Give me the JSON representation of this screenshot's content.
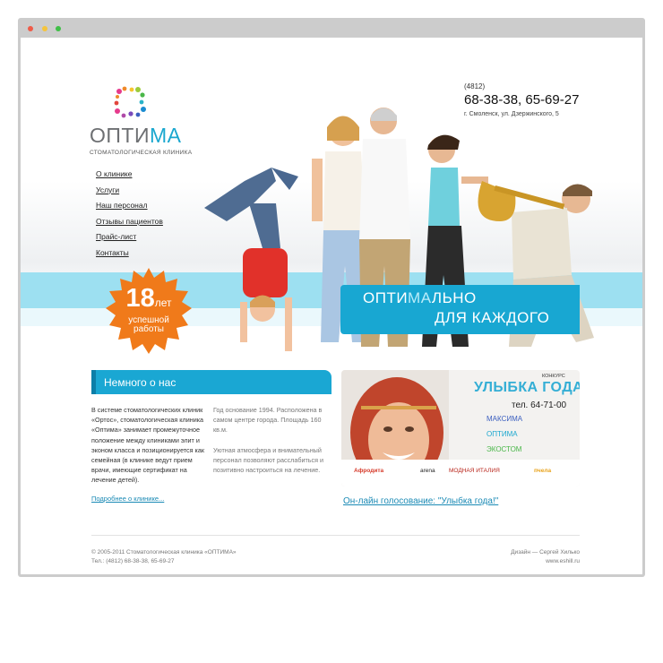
{
  "logo": {
    "name_main": "ОПТИ",
    "name_accent": "МА",
    "subtitle": "стоматологическая клиника"
  },
  "nav": {
    "items": [
      "О клинике",
      "Услуги",
      "Наш персонал",
      "Отзывы пациентов",
      "Прайс-лист",
      "Контакты"
    ]
  },
  "contacts": {
    "code": "(4812)",
    "phones": "68-38-38, 65-69-27",
    "address": "г. Смоленск, ул. Дзержинского, 5"
  },
  "badge": {
    "number": "18",
    "unit": "лет",
    "line1": "успешной",
    "line2": "работы"
  },
  "slogan": {
    "line1_a": "ОПТИ",
    "line1_b": "МА",
    "line1_c": "ЛЬНО",
    "line2": "ДЛЯ КАЖДОГО"
  },
  "about": {
    "heading": "Немного о нас",
    "col1": "В системе стоматологических клиник «Ортос», стоматологическая клиника «Оптима» занимает промежуточное положение между клиниками элит и эконом класса и позиционируется как семейная (в клинике ведут прием врачи, имеющие сертификат на лечение детей).",
    "col2_p1": "Год основание 1994. Расположена в самом центре города. Площадь 160 кв.м.",
    "col2_p2": "Уютная атмосфера и внимательный персонал позволяют расслабиться и позитивно настроиться на лечение.",
    "more": "Подробнее о клинике..."
  },
  "promo": {
    "small": "КОНКУРС",
    "title": "УЛЫБКА ГОДА",
    "tel": "тел. 64-71-00",
    "brands": [
      "МАКСИМА",
      "ОПТИМА",
      "ЭКОСТОМ"
    ],
    "sponsors": [
      "Афродита",
      "arena",
      "МОДНАЯ ИТАЛИЯ",
      "пчела"
    ]
  },
  "vote_link": "Он-лайн голосование: \"Улыбка года!\"",
  "footer": {
    "copyright": "© 2005-2011 Стоматологическая клиника «ОПТИМА»",
    "phone": "Тел.: (4812) 68-38-38, 65-69-27",
    "design": "Дизайн — Сергей Хилько",
    "site": "www.eshill.ru"
  },
  "colors": {
    "accent": "#1aa7d3",
    "badge": "#f07a1a",
    "band": "#9de0f1"
  }
}
